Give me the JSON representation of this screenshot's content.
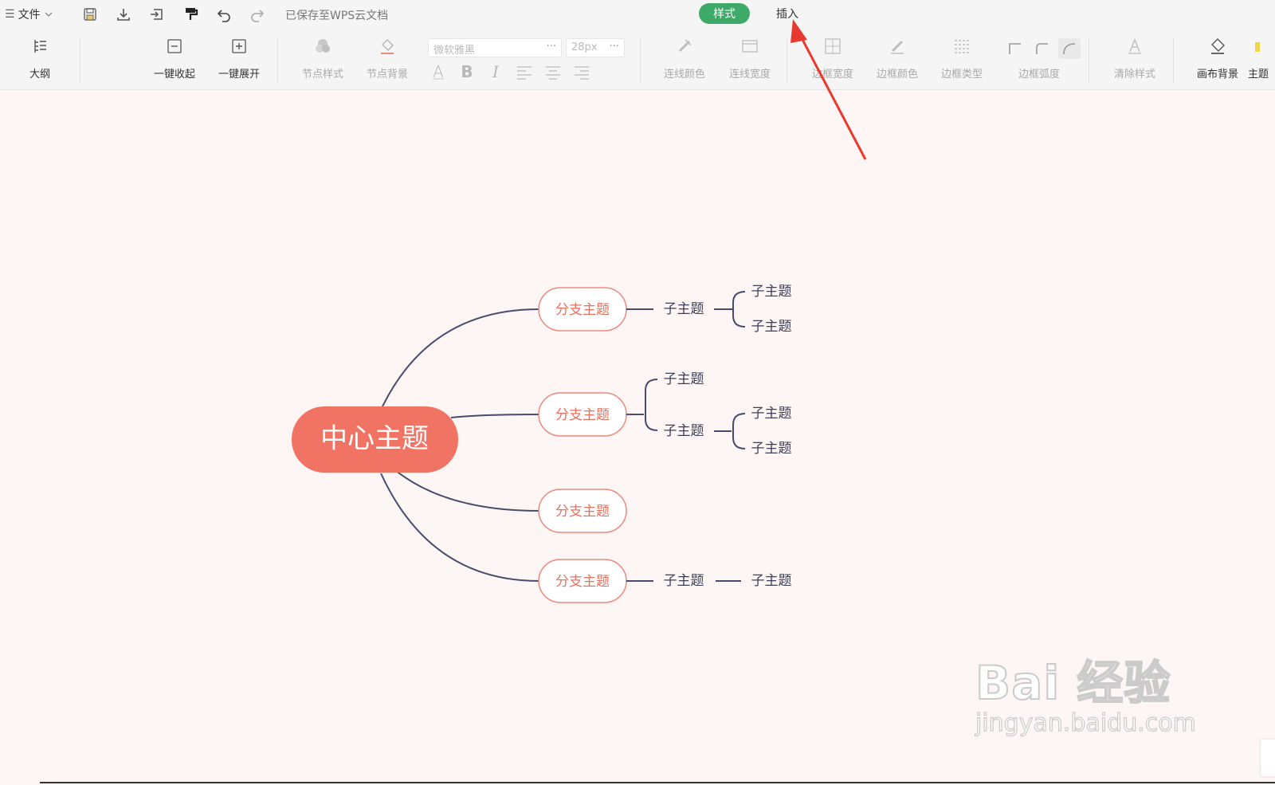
{
  "header": {
    "menu_label": "文件",
    "save_status": "已保存至WPS云文档",
    "tabs": [
      {
        "label": "样式",
        "active": true
      },
      {
        "label": "插入",
        "active": false
      }
    ],
    "accent_color": "#3dab67"
  },
  "toolbar": {
    "outline": "大纲",
    "collapse_all": "一键收起",
    "expand_all": "一键展开",
    "node_style": "节点样式",
    "node_background": "节点背景",
    "font_family": "微软雅黑",
    "font_size": "28px",
    "more": "···",
    "bold": "B",
    "italic": "I",
    "font_color_glyph": "A",
    "line_color": "连线颜色",
    "line_width": "连线宽度",
    "border_width": "边框宽度",
    "border_color": "边框颜色",
    "border_type": "边框类型",
    "border_radius": "边框弧度",
    "clear_style": "清除样式",
    "canvas_background": "画布背景",
    "theme": "主题"
  },
  "mindmap": {
    "center": "中心主题",
    "branches": [
      {
        "label": "分支主题",
        "children": [
          {
            "label": "子主题",
            "children": [
              "子主题",
              "子主题"
            ]
          }
        ]
      },
      {
        "label": "分支主题",
        "children": [
          {
            "label": "子主题",
            "children": []
          },
          {
            "label": "子主题",
            "children": [
              "子主题",
              "子主题"
            ]
          }
        ]
      },
      {
        "label": "分支主题",
        "children": []
      },
      {
        "label": "分支主题",
        "children": [
          {
            "label": "子主题",
            "children": [
              "子主题"
            ]
          }
        ]
      }
    ],
    "colors": {
      "center_fill": "#f07363",
      "branch_border": "#ec8a7d",
      "branch_text": "#e8705f",
      "line": "#474b6e",
      "background": "#fdf6f4"
    }
  },
  "annotation": {
    "arrow_color": "#e8392f"
  },
  "watermark": {
    "main": "Bai 经验",
    "sub": "jingyan.baidu.com"
  }
}
